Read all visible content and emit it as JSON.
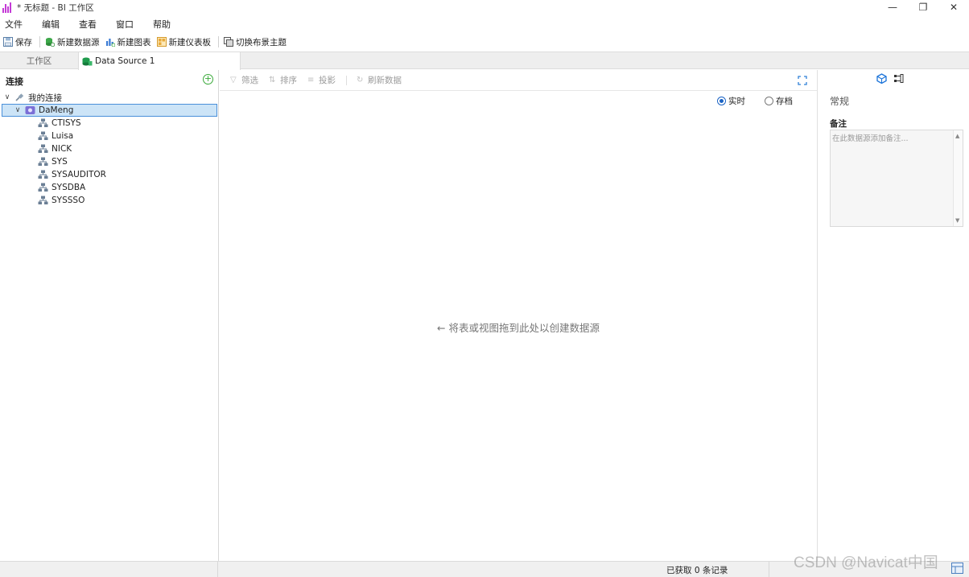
{
  "window": {
    "title": "* 无标题 - BI 工作区",
    "minimize": "—",
    "maximize": "❐",
    "close": "✕"
  },
  "menu": [
    "文件",
    "编辑",
    "查看",
    "窗口",
    "帮助"
  ],
  "toolbar": {
    "save": "保存",
    "new_datasource": "新建数据源",
    "new_chart": "新建图表",
    "new_dashboard": "新建仪表板",
    "switch_theme": "切换布景主题"
  },
  "tabs": {
    "workspace": "工作区",
    "datasource": "Data Source 1"
  },
  "connections": {
    "header": "连接",
    "group": "我的连接",
    "connection": "DaMeng",
    "schemas": [
      "CTISYS",
      "Luisa",
      "NICK",
      "SYS",
      "SYSAUDITOR",
      "SYSDBA",
      "SYSSSO"
    ]
  },
  "center": {
    "filter": "筛选",
    "sort": "排序",
    "project": "投影",
    "refresh": "刷新数据",
    "radio_live": "实时",
    "radio_archive": "存档",
    "radio_selected": "实时",
    "drop_hint": "将表或视图拖到此处以创建数据源"
  },
  "properties": {
    "section": "常规",
    "notes_label": "备注",
    "notes_placeholder": "在此数据源添加备注..."
  },
  "status": {
    "records": "已获取 0 条记录"
  },
  "watermark": "CSDN @Navicat中国",
  "colors": {
    "accent": "#1a63c4",
    "selection": "#cce4f7",
    "app_icon": "#c43bd6",
    "add": "#3aaa3a"
  },
  "icons": {
    "app": "bar-chart-icon",
    "save": "floppy-icon",
    "new_datasource": "datasource-add-icon",
    "new_chart": "chart-add-icon",
    "new_dashboard": "dashboard-add-icon",
    "theme": "theme-icon",
    "schema": "schema-icon",
    "connection": "dameng-icon",
    "group": "plug-icon"
  }
}
